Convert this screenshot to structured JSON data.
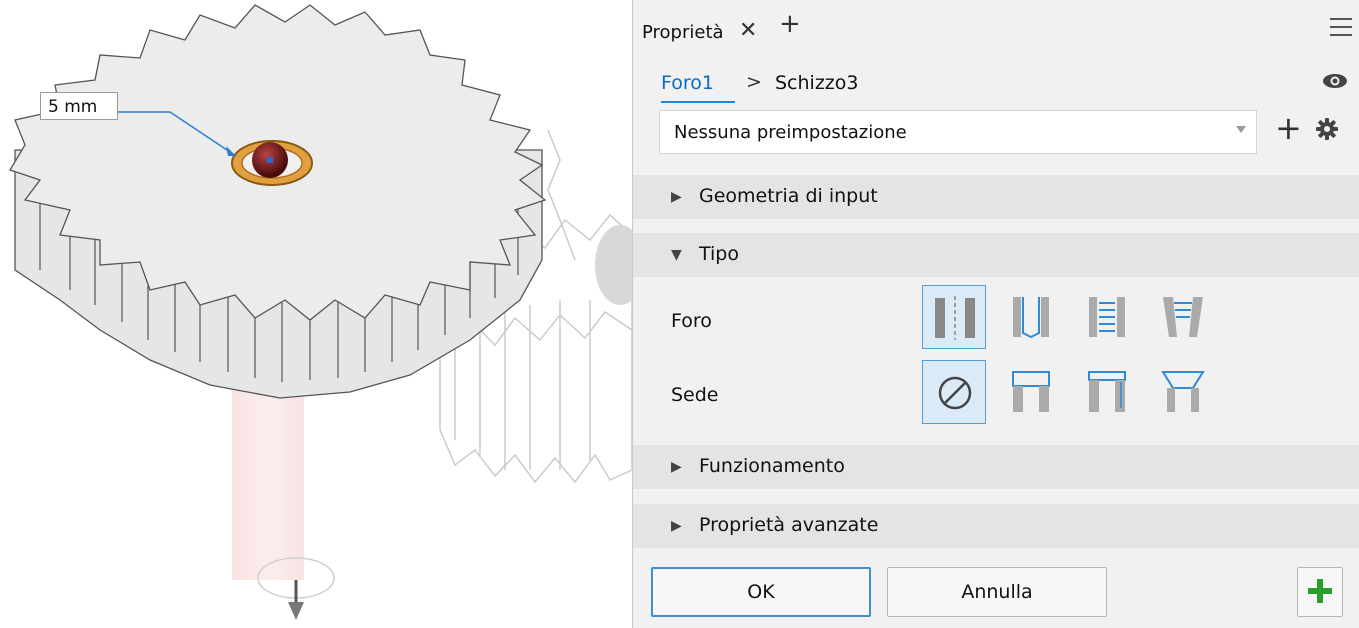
{
  "viewport": {
    "dimension_label": "5 mm"
  },
  "panel": {
    "tab_label": "Proprietà",
    "tab_close": "✕",
    "tab_add": "+",
    "breadcrumb": {
      "active": "Foro1",
      "separator": ">",
      "item": "Schizzo3"
    },
    "preset": {
      "value": "Nessuna preimpostazione",
      "add_label": "+"
    },
    "sections": {
      "input_geometry": "Geometria di input",
      "type": "Tipo",
      "behavior": "Funzionamento",
      "advanced": "Proprietà avanzate"
    },
    "type_rows": {
      "hole_label": "Foro",
      "seat_label": "Sede"
    },
    "buttons": {
      "ok": "OK",
      "cancel": "Annulla"
    }
  },
  "colors": {
    "accent": "#1f86d6",
    "panel_bg": "#f1f1f1",
    "section_bg": "#e4e4e4",
    "selected_bg": "#dbeaf7",
    "apply_green": "#2a9d2a"
  }
}
